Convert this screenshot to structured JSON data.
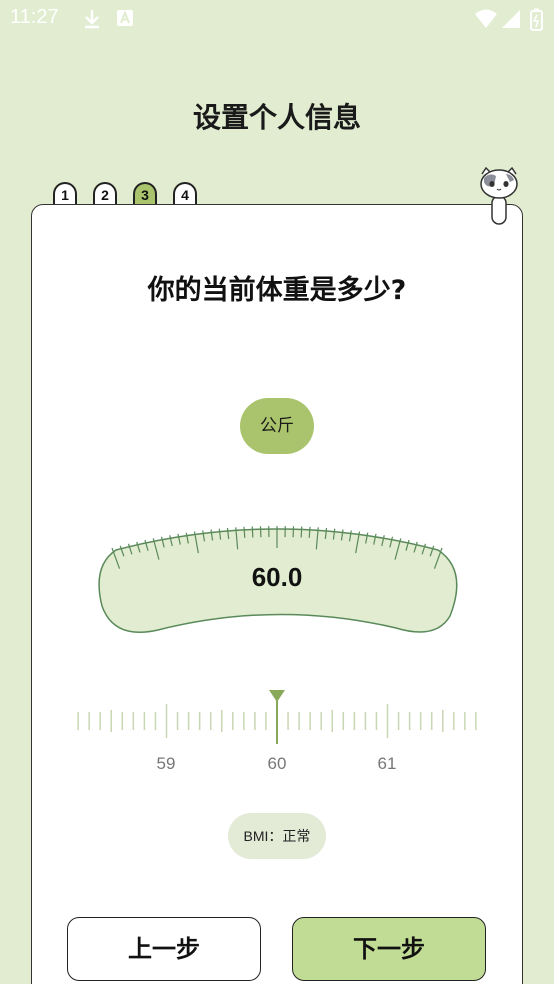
{
  "status_bar": {
    "time": "11:27",
    "icons": [
      "download-icon",
      "a-notification-icon",
      "wifi-icon",
      "signal-icon",
      "battery-icon"
    ]
  },
  "page_title": "设置个人信息",
  "steps": [
    "1",
    "2",
    "3",
    "4"
  ],
  "active_step": 3,
  "question": "你的当前体重是多少?",
  "unit": "公斤",
  "weight_value": "60.0",
  "ruler": {
    "labels": [
      "59",
      "60",
      "61"
    ],
    "selected": 60.0
  },
  "bmi_text": "BMI：正常",
  "buttons": {
    "prev": "上一步",
    "next": "下一步"
  },
  "colors": {
    "background": "#e1ecd0",
    "accent": "#a9c46c",
    "scale_fill": "#e1ecd0",
    "scale_stroke": "#5a8a5a",
    "next_button": "#c1dc94"
  }
}
